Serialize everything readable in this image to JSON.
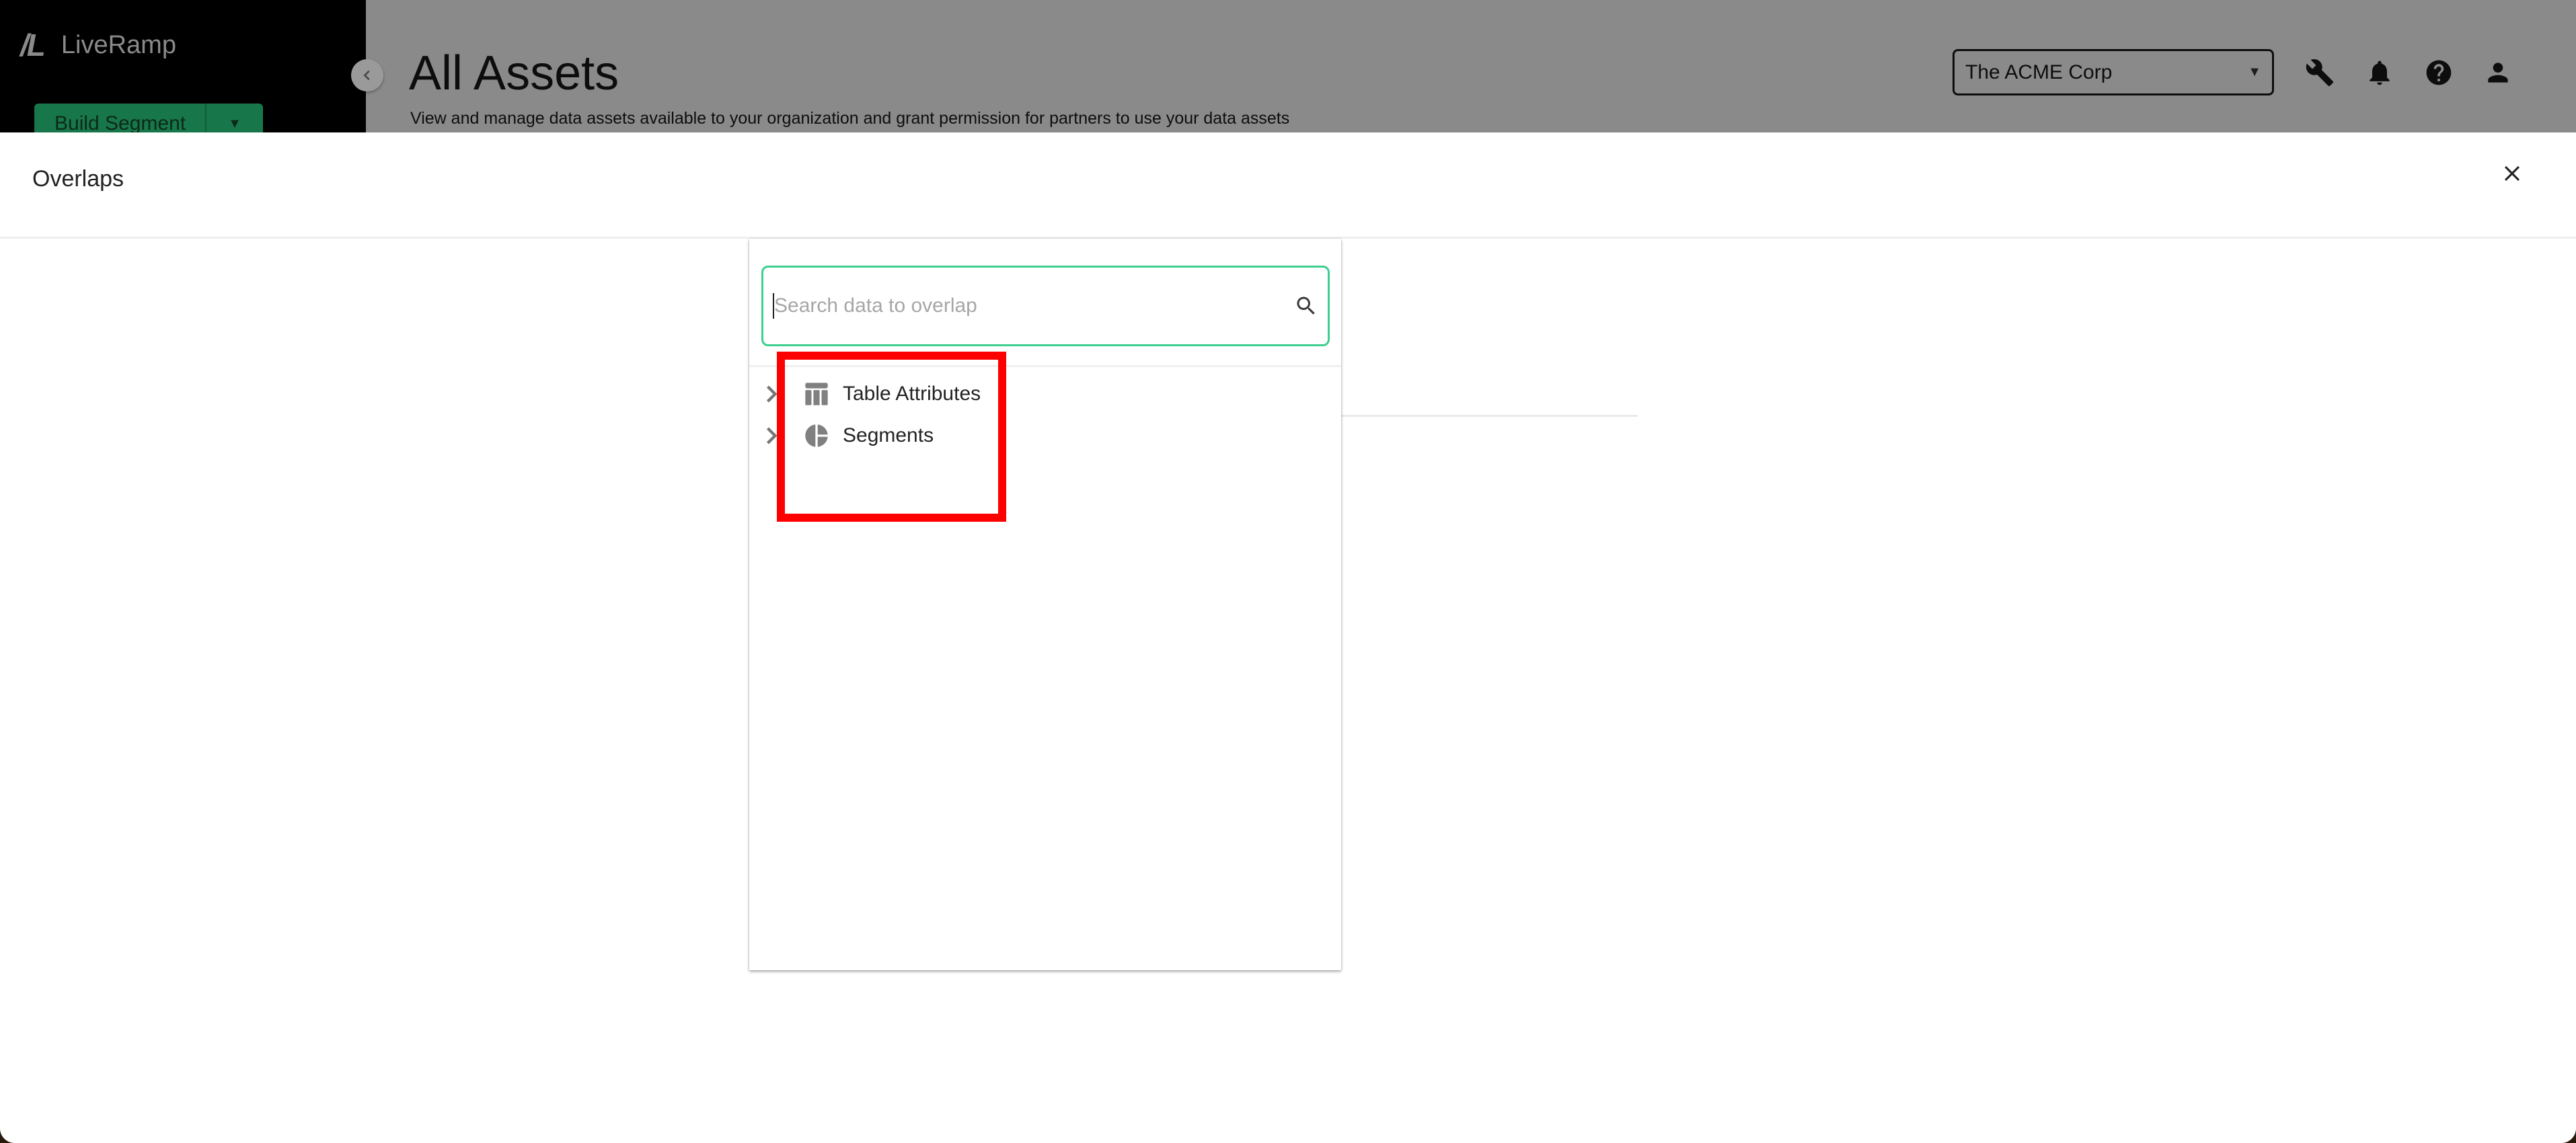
{
  "app": {
    "brand": "LiveRamp",
    "brand_mark": "/L"
  },
  "sidebar": {
    "primary_button_label": "Build Segment",
    "collapse_icon": "chevron-left-icon"
  },
  "header": {
    "title": "All Assets",
    "description": "View and manage data assets available to your organization and grant permission for partners to use your data assets",
    "org_selector": {
      "selected": "The ACME Corp"
    },
    "icons": [
      "wrench-icon",
      "bell-icon",
      "help-icon",
      "person-icon"
    ]
  },
  "drawer": {
    "title": "Overlaps",
    "close_icon": "close-icon",
    "search": {
      "placeholder": "Search data to overlap",
      "value": ""
    },
    "tree": [
      {
        "label": "Table Attributes",
        "icon": "table-icon",
        "expanded": false
      },
      {
        "label": "Segments",
        "icon": "pie-chart-icon",
        "expanded": false
      }
    ]
  },
  "colors": {
    "brand_green": "#18774a",
    "search_focus": "#3ccf8e",
    "highlight": "#ff0000",
    "overlay_gray": "#8a8a8a"
  }
}
